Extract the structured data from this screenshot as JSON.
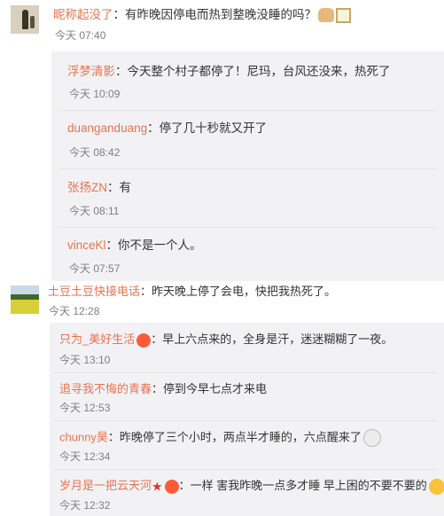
{
  "comments": [
    {
      "author": "昵称起没了",
      "text": "：有昨晚因停电而热到整晚没睡的吗？",
      "emoji": [
        "hands-raised-icon",
        "box-icon"
      ],
      "time": "今天 07:40",
      "replies": [
        {
          "author": "浮梦清影",
          "text": "：今天整个村子都停了！尼玛，台风还没来，热死了",
          "time": "今天 10:09"
        },
        {
          "author": "duanganduang",
          "text": "：停了几十秒就又开了",
          "time": "今天 08:42"
        },
        {
          "author": "张扬ZN",
          "text": "：有",
          "time": "今天 08:11"
        },
        {
          "author": "vinceKl",
          "text": "：你不是一个人。",
          "time": "今天 07:57"
        }
      ]
    },
    {
      "author": "土豆土豆快接电话",
      "text": "：昨天晚上停了会电，快把我热死了。",
      "time": "今天 12:28",
      "replies": [
        {
          "author": "只为_美好生活",
          "text": "：早上六点来的，全身是汗，迷迷糊糊了一夜。",
          "time": "今天 13:10"
        },
        {
          "author": "追寻我不悔的青春",
          "text": "：停到今早七点才来电",
          "time": "今天 12:53"
        },
        {
          "author": "chunny昊",
          "text": "：昨晚停了三个小时，两点半才睡的，六点醒来了",
          "time": "今天 12:34"
        },
        {
          "author": "岁月是一把云天河",
          "text": "：一样 害我昨晚一点多才睡 早上困的不要不要的",
          "time": "今天 12:32"
        }
      ]
    }
  ]
}
